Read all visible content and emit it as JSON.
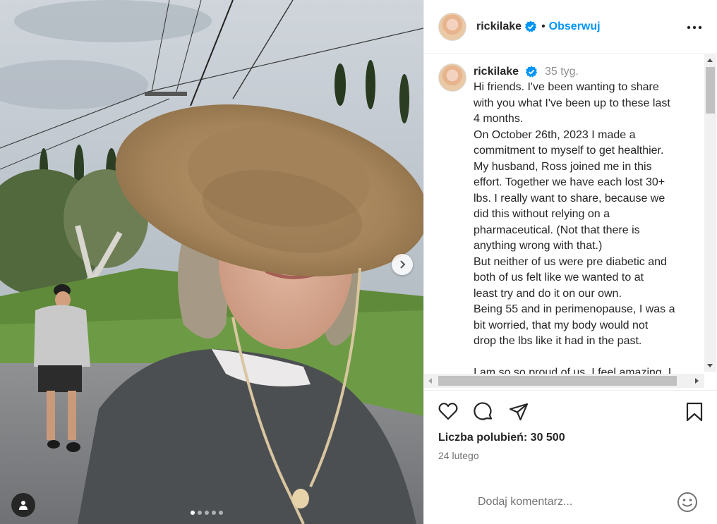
{
  "post": {
    "username": "rickilake",
    "follow_label": "Obserwuj",
    "separator": "•",
    "time_ago": "35 tyg.",
    "caption": "Hi friends. I've been wanting to share\nwith you what I've been up to these last\n4 months.\nOn October 26th, 2023 I made a\ncommitment to myself to get healthier.\nMy husband, Ross joined me in this\neffort. Together we have each lost 30+\nlbs. I really want to share, because we\ndid this without relying on a\npharmaceutical. (Not that there is\nanything wrong with that.)\nBut neither of us were pre diabetic and\nboth of us felt like we wanted to at\nleast try and do it on our own.\nBeing 55 and in perimenopause, I was a\nbit worried, that my body would not\ndrop the lbs like it had in the past.\n\nI am so so proud of us. I feel amazing. I",
    "likes_text": "Liczba polubień: 30 500",
    "date": "24 lutego",
    "comment_placeholder": "Dodaj komentarz..."
  },
  "carousel": {
    "slide_count": 5,
    "active_index": 0
  },
  "icons": {
    "verified": "verified-badge-icon",
    "more": "more-options-icon",
    "like": "heart-icon",
    "comment": "comment-icon",
    "share": "share-icon",
    "save": "bookmark-icon",
    "emoji": "emoji-icon",
    "next": "chevron-right-icon",
    "user_tag": "user-tag-icon"
  },
  "colors": {
    "accent": "#0095f6",
    "verified": "#0095f6",
    "text": "#262626",
    "muted": "#737373"
  }
}
